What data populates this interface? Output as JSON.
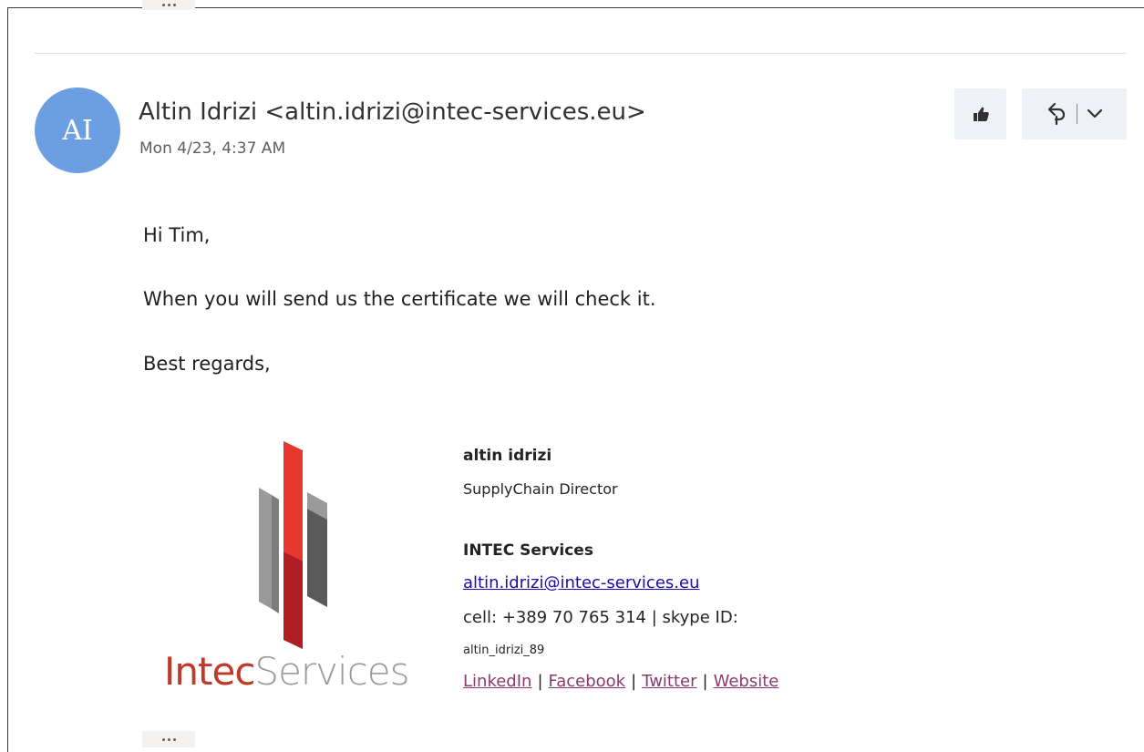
{
  "sender": {
    "initials": "AI",
    "name_line": "Altin Idrizi <altin.idrizi@intec-services.eu>",
    "date": "Mon 4/23, 4:37 AM"
  },
  "actions": {
    "like_icon": "thumbs-up-icon",
    "reply_icon": "reply-icon",
    "more_icon": "chevron-down-icon"
  },
  "body": {
    "greeting": "Hi Tim,",
    "message": "When you will send us the certificate we will check it.",
    "closing": "Best regards,"
  },
  "signature": {
    "logo_text_a": "Intec",
    "logo_text_b": "Services",
    "name": "altin idrizi",
    "title": "SupplyChain Director",
    "company": "INTEC Services",
    "email": "altin.idrizi@intec-services.eu",
    "cell_line": "cell: +389 70 765 314 | skype ID:",
    "skype_id": "altin_idrizi_89",
    "links": [
      "LinkedIn",
      "Facebook",
      "Twitter",
      "Website"
    ]
  },
  "colors": {
    "avatar": "#6c9fe2",
    "link": "#1a0dab",
    "social_link": "#8b3a6b",
    "logo_red": "#e8372d",
    "logo_dark_red": "#b01e23"
  }
}
